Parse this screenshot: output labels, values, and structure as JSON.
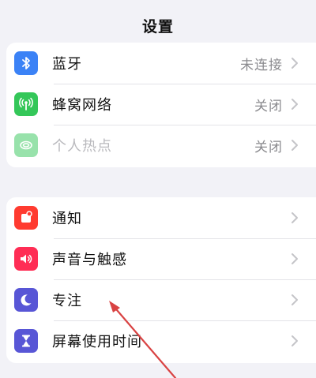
{
  "nav": {
    "title": "设置"
  },
  "group1": [
    {
      "label": "蓝牙",
      "value": "未连接",
      "icon": "bluetooth-icon",
      "color": "#3b82f6"
    },
    {
      "label": "蜂窝网络",
      "value": "关闭",
      "icon": "cellular-icon",
      "color": "#34c759"
    },
    {
      "label": "个人热点",
      "value": "关闭",
      "icon": "hotspot-icon",
      "color": "#34c759"
    }
  ],
  "group2": [
    {
      "label": "通知",
      "icon": "bell-icon",
      "color": "#ff3b30"
    },
    {
      "label": "声音与触感",
      "icon": "speaker-icon",
      "color": "#ff2d55"
    },
    {
      "label": "专注",
      "icon": "moon-icon",
      "color": "#5856d6"
    },
    {
      "label": "屏幕使用时间",
      "icon": "hourglass-icon",
      "color": "#5856d6"
    }
  ]
}
